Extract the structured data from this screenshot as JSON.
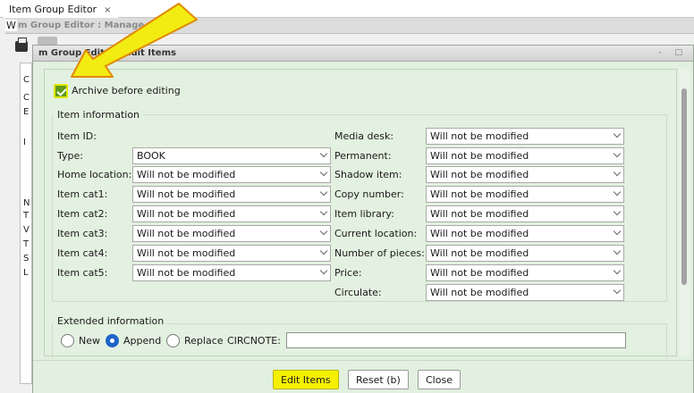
{
  "app_tab": {
    "label": "Item Group Editor",
    "close": "×"
  },
  "window": {
    "title": "m Group Editor : Manage",
    "w_prefix": "W"
  },
  "bg_letters": [
    "C",
    "C",
    "E",
    "I",
    "N",
    "T",
    "V",
    "T",
    "S",
    "L"
  ],
  "dialog": {
    "title": "m Group Editor : Edit Items",
    "controls": "- □"
  },
  "archive": {
    "label": "Archive before editing",
    "checked": true
  },
  "item_info": {
    "legend": "Item information",
    "left": [
      {
        "label": "Item ID:",
        "value": ""
      },
      {
        "label": "Type:",
        "value": "BOOK"
      },
      {
        "label": "Home location:",
        "value": "Will not be modified"
      },
      {
        "label": "Item cat1:",
        "value": "Will not be modified"
      },
      {
        "label": "Item cat2:",
        "value": "Will not be modified"
      },
      {
        "label": "Item cat3:",
        "value": "Will not be modified"
      },
      {
        "label": "Item cat4:",
        "value": "Will not be modified"
      },
      {
        "label": "Item cat5:",
        "value": "Will not be modified"
      }
    ],
    "right": [
      {
        "label": "Media desk:",
        "value": "Will not be modified"
      },
      {
        "label": "Permanent:",
        "value": "Will not be modified"
      },
      {
        "label": "Shadow item:",
        "value": "Will not be modified"
      },
      {
        "label": "Copy number:",
        "value": "Will not be modified"
      },
      {
        "label": "Item library:",
        "value": "Will not be modified"
      },
      {
        "label": "Current location:",
        "value": "Will not be modified"
      },
      {
        "label": "Number of pieces:",
        "value": "Will not be modified"
      },
      {
        "label": "Price:",
        "value": "Will not be modified"
      },
      {
        "label": "Circulate:",
        "value": "Will not be modified"
      }
    ]
  },
  "extended": {
    "legend": "Extended information",
    "options": [
      "New",
      "Append",
      "Replace"
    ],
    "selected": "Append",
    "field_label": "CIRCNOTE:",
    "field_value": ""
  },
  "buttons": {
    "edit": "Edit Items",
    "reset": "Reset (b)",
    "close": "Close"
  },
  "colors": {
    "dialog_bg": "#e1f0df",
    "highlight": "#f4f000",
    "checkbox": "#5f9a1c",
    "radio_on": "#1f64c8",
    "arrow": "#f2ec12"
  }
}
